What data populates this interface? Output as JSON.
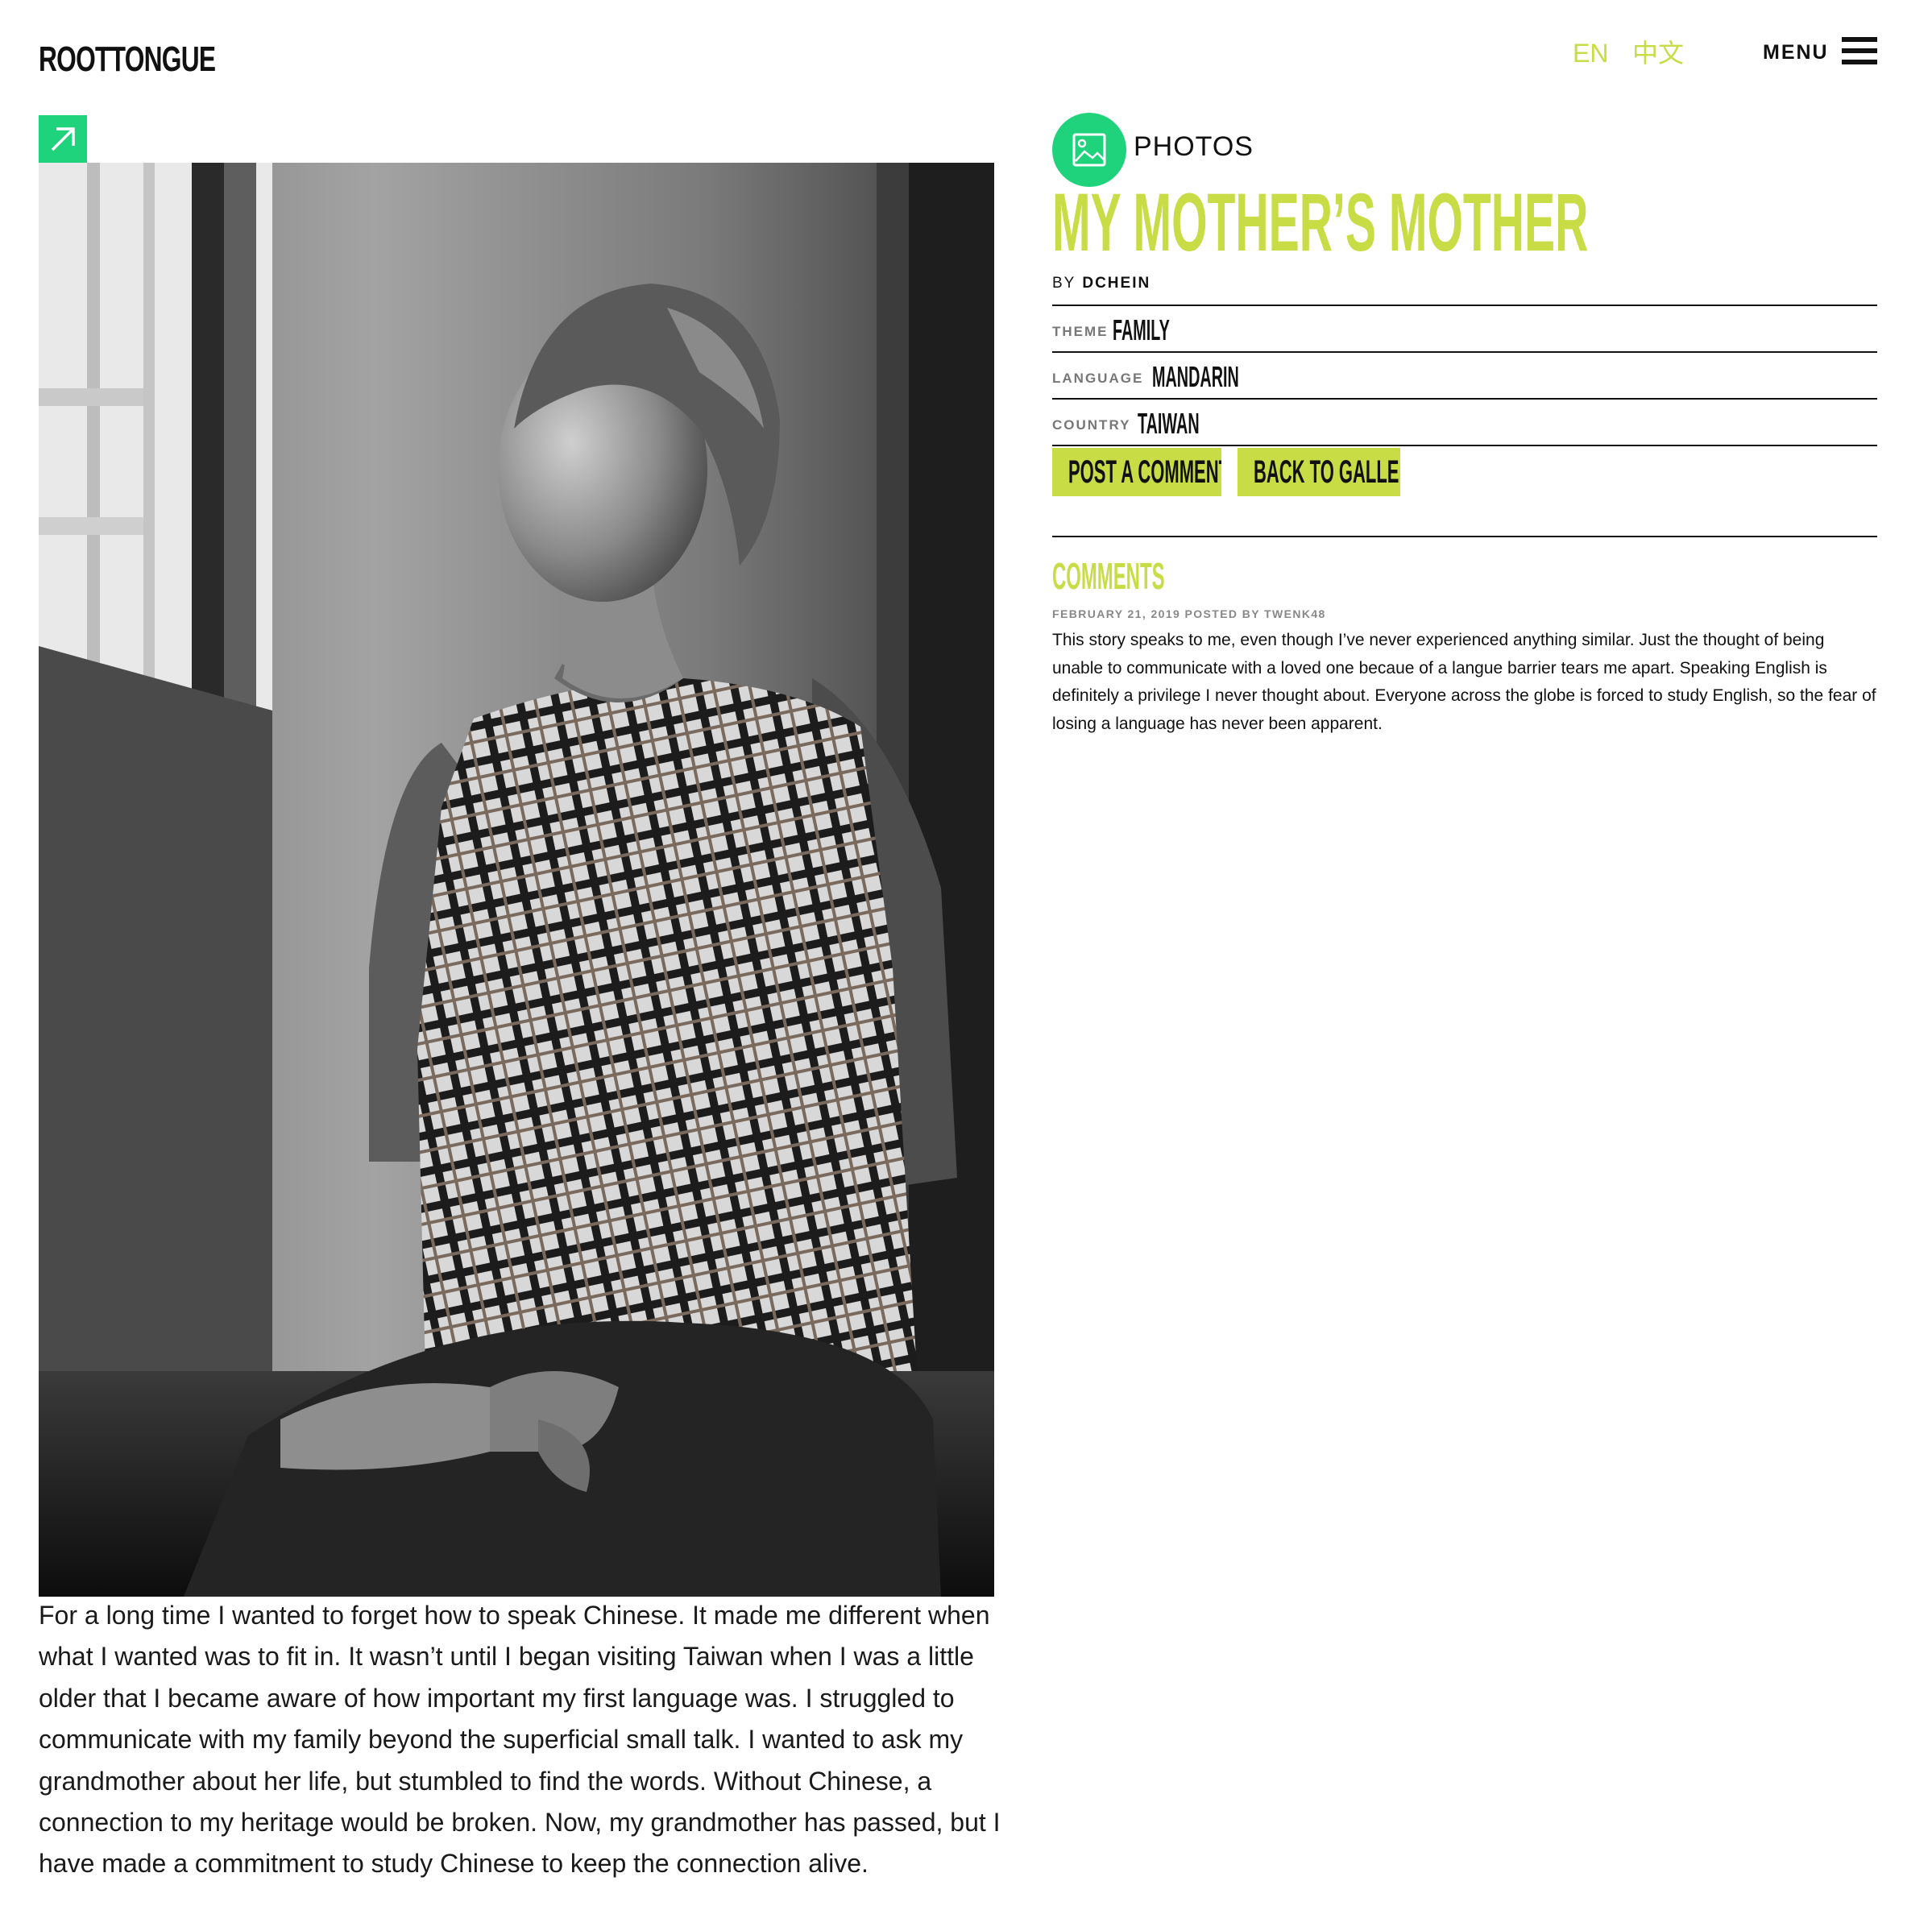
{
  "header": {
    "logo_text": "ROOTTONGUE",
    "lang_en": "EN",
    "lang_zh": "中文",
    "menu_label": "MENU"
  },
  "colors": {
    "accent": "#c7dc45",
    "badge_green": "#1fd37c",
    "text": "#111111"
  },
  "icons": {
    "expand": "arrow-up-right-icon",
    "type": "image-icon",
    "menu": "hamburger-icon"
  },
  "post": {
    "type_label": "PHOTOS",
    "title": "MY MOTHER’S MOTHER",
    "by_label": "BY",
    "author": "DCHEIN",
    "meta": {
      "theme_label": "THEME",
      "theme_value": "FAMILY",
      "language_label": "LANGUAGE",
      "language_value": "MANDARIN",
      "country_label": "COUNTRY",
      "country_value": "TAIWAN"
    },
    "buttons": {
      "post_comment": "POST A COMMENT",
      "back_to_gallery": "BACK TO GALLERY"
    },
    "story": "For a long time I wanted to forget how to speak Chinese. It made me different when what I wanted was to fit in. It wasn’t until I began visiting Taiwan when I was a little older that I became aware of how important my first language was. I struggled to communicate with my family beyond the superficial small talk. I wanted to ask my grandmother about her life, but stumbled to find the words. Without Chinese, a connection to my heritage would be broken. Now, my grandmother has passed, but I have made a commitment to study Chinese to keep the connection alive."
  },
  "comments": {
    "heading": "COMMENTS",
    "items": [
      {
        "meta": "FEBRUARY 21, 2019 POSTED BY TWENK48",
        "body": "This story speaks to me, even though I’ve never experienced anything similar. Just the thought of being unable to communicate with a loved one becaue of a langue barrier tears me apart. Speaking English is definitely a privilege I never thought about. Everyone across the globe is forced to study English, so the fear of losing a language has never been apparent."
      }
    ]
  }
}
